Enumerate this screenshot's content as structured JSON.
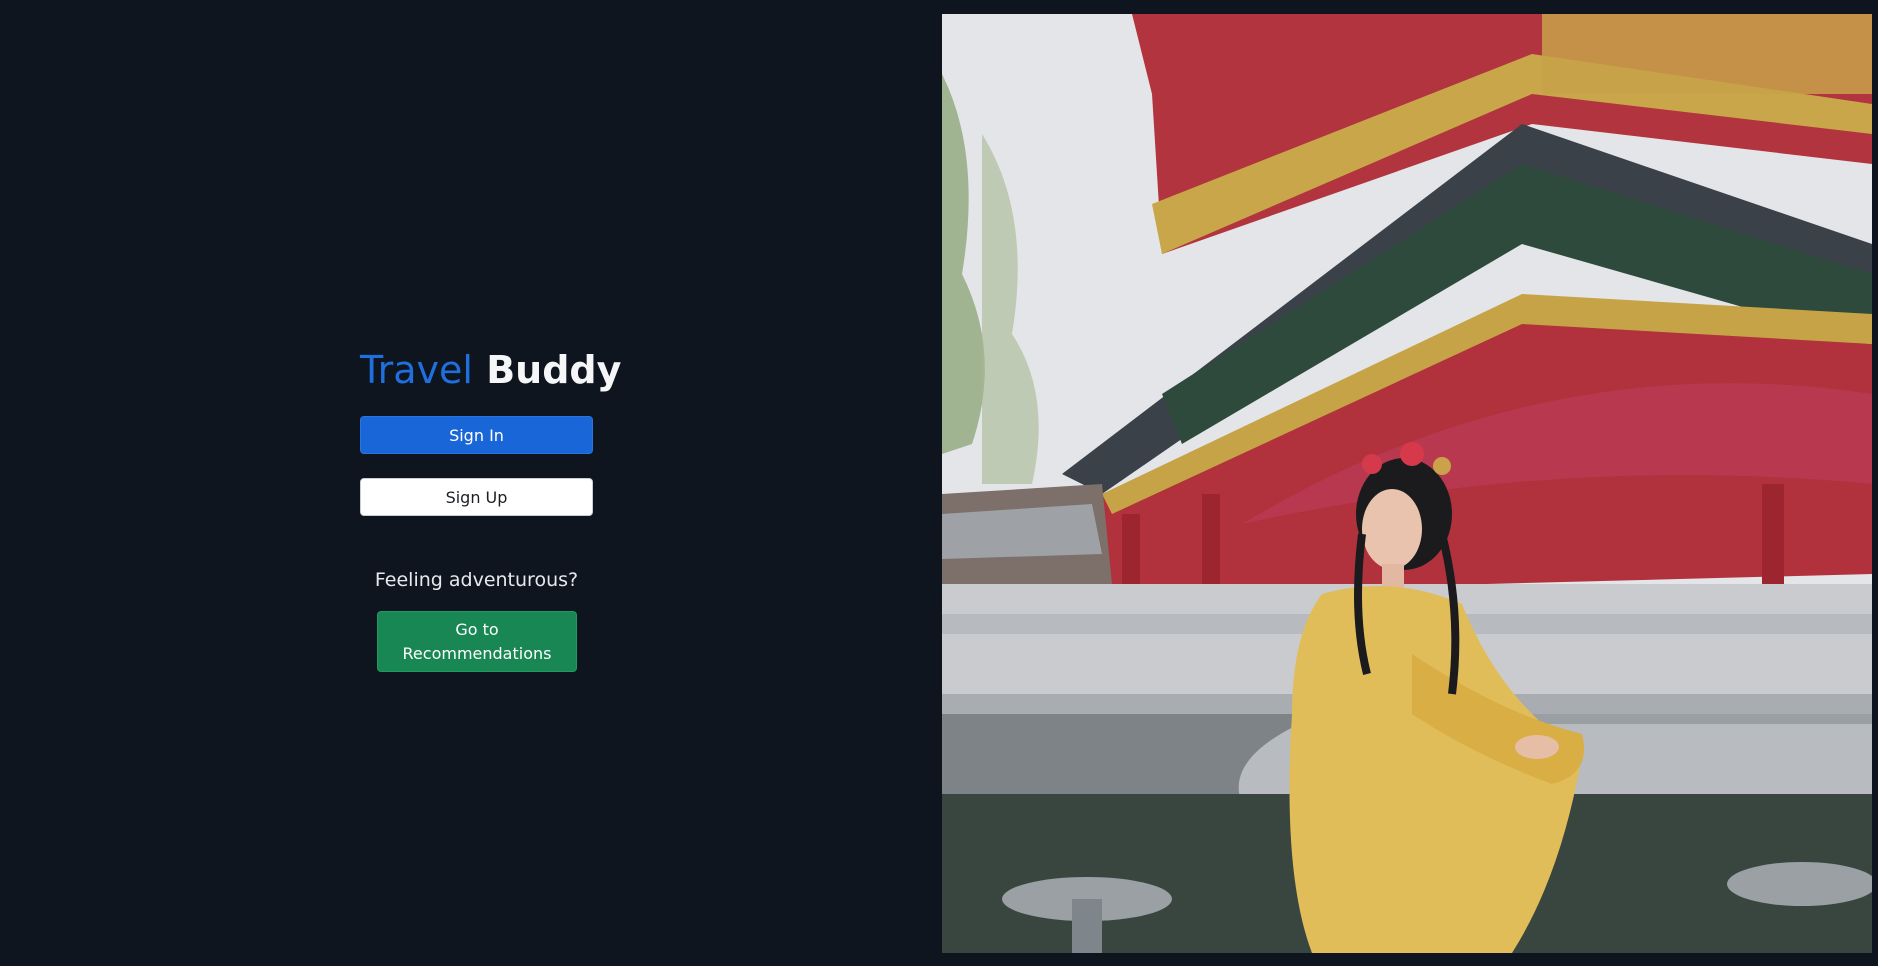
{
  "brand": {
    "word1": "Travel",
    "word2": "Buddy"
  },
  "auth": {
    "sign_in_label": "Sign In",
    "sign_up_label": "Sign Up"
  },
  "explore": {
    "prompt": "Feeling adventurous?",
    "button_label": "Go to Recommendations"
  },
  "colors": {
    "background": "#0f151e",
    "brand_accent": "#1f6fde",
    "primary_button": "#1966d8",
    "success_button": "#198754"
  },
  "hero_image": {
    "subject": "woman in yellow traditional dress in front of red pagoda"
  }
}
